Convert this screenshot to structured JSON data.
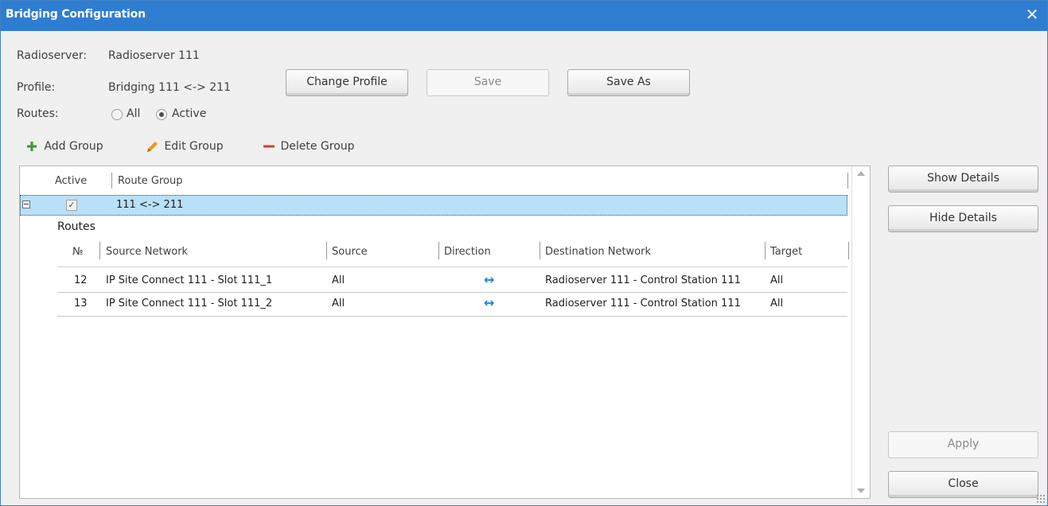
{
  "window": {
    "title": "Bridging Configuration",
    "close_glyph": "✕"
  },
  "info": {
    "radioserver_label": "Radioserver:",
    "radioserver_value": "Radioserver 111",
    "profile_label": "Profile:",
    "profile_value": "Bridging 111 <-> 211",
    "routes_label": "Routes:",
    "routes_options": [
      "All",
      "Active"
    ],
    "routes_selected": "Active"
  },
  "profile_buttons": {
    "change": "Change Profile",
    "save": "Save",
    "save_as": "Save As"
  },
  "toolbar": {
    "add_group": "Add Group",
    "edit_group": "Edit Group",
    "delete_group": "Delete Group",
    "add_color": "#3a9a2a",
    "edit_color": "#e89a1a",
    "delete_color": "#d83a2a"
  },
  "groups_table": {
    "columns": [
      "Active",
      "Route Group"
    ],
    "rows": [
      {
        "active": true,
        "route_group": "111 <-> 211",
        "expanded": true
      }
    ]
  },
  "routes_table": {
    "title": "Routes",
    "columns": [
      "№",
      "Source Network",
      "Source",
      "Direction",
      "Destination Network",
      "Target"
    ],
    "rows": [
      {
        "no": "12",
        "source_network": "IP Site Connect 111 - Slot 111_1",
        "source": "All",
        "direction": "↔",
        "destination_network": "Radioserver 111 - Control Station  111",
        "target": "All"
      },
      {
        "no": "13",
        "source_network": "IP Site Connect 111 - Slot 111_2",
        "source": "All",
        "direction": "↔",
        "destination_network": "Radioserver 111 - Control Station  111",
        "target": "All"
      }
    ]
  },
  "side_buttons": {
    "show_details": "Show Details",
    "hide_details": "Hide Details",
    "apply": "Apply",
    "close": "Close"
  },
  "colors": {
    "titlebar": "#2f7dd1",
    "selected_row": "#b8e0f8",
    "arrow": "#1e88d0"
  }
}
